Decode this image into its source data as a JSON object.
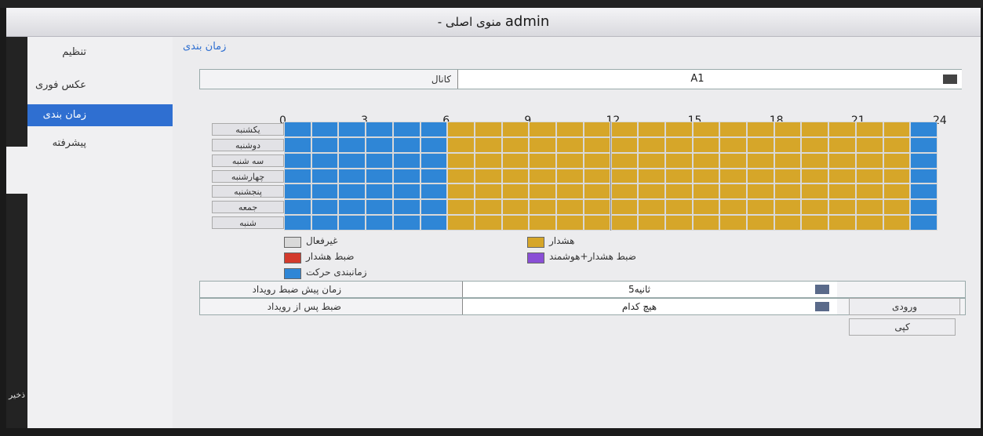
{
  "window": {
    "title_brand": "admin",
    "title_rest": " - منوی اصلی"
  },
  "sidebar": {
    "items": [
      {
        "label": "تنظیم"
      },
      {
        "label": "عکس فوری"
      },
      {
        "label": "زمان بندی",
        "active": true
      },
      {
        "label": "پیشرفته"
      }
    ],
    "bottom_label": "ذخیر"
  },
  "breadcrumb": "زمان بندی",
  "channel": {
    "label": "کانال",
    "value": "A1"
  },
  "schedule": {
    "hours": [
      "0",
      "3",
      "6",
      "9",
      "12",
      "15",
      "18",
      "21",
      "24"
    ],
    "days": [
      "یکشنبه",
      "دوشنبه",
      "سه شنبه",
      "چهارشنبه",
      "پنجشنبه",
      "جمعه",
      "شنبه"
    ],
    "slots_per_day": 24,
    "pattern": "hours 0-5 motion, 6-22 alarm, 23 motion (all days)"
  },
  "legend": {
    "disabled": "غیرفعال",
    "alarm": "هشدار",
    "alarm_record": "ضبط هشدار",
    "alarm_smart": "ضبط هشدار+هوشمند",
    "motion": "زمانبندی حرکت",
    "colors": {
      "disabled": "#d9d9d9",
      "alarm": "#d6a629",
      "alarm_record": "#d33a2c",
      "alarm_smart": "#8a4fd6",
      "motion": "#2f86d6"
    }
  },
  "pre_record": {
    "label": "زمان پیش ضبط رویداد",
    "value": "5ثانیه"
  },
  "post_record": {
    "label": "ضبط پس از رویداد",
    "value": "هیچ کدام"
  },
  "buttons": {
    "input": "ورودی",
    "copy": "کپی"
  }
}
